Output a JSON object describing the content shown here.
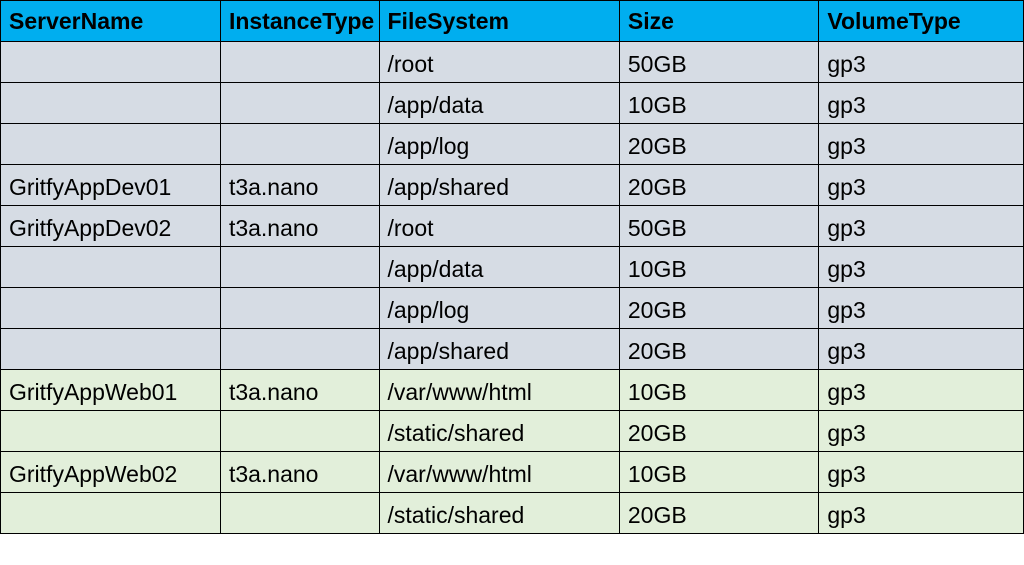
{
  "headers": {
    "server": "ServerName",
    "instance": "InstanceType",
    "fs": "FileSystem",
    "size": "Size",
    "volume": "VolumeType"
  },
  "rows": [
    {
      "server": "",
      "instance": "",
      "fs": "/root",
      "size": "50GB",
      "volume": "gp3",
      "group": "a"
    },
    {
      "server": "",
      "instance": "",
      "fs": "/app/data",
      "size": "10GB",
      "volume": "gp3",
      "group": "a"
    },
    {
      "server": "",
      "instance": "",
      "fs": "/app/log",
      "size": "20GB",
      "volume": "gp3",
      "group": "a"
    },
    {
      "server": "GritfyAppDev01",
      "instance": "t3a.nano",
      "fs": "/app/shared",
      "size": "20GB",
      "volume": "gp3",
      "group": "a"
    },
    {
      "server": "GritfyAppDev02",
      "instance": "t3a.nano",
      "fs": "/root",
      "size": "50GB",
      "volume": "gp3",
      "group": "a"
    },
    {
      "server": "",
      "instance": "",
      "fs": "/app/data",
      "size": "10GB",
      "volume": "gp3",
      "group": "a"
    },
    {
      "server": "",
      "instance": "",
      "fs": "/app/log",
      "size": "20GB",
      "volume": "gp3",
      "group": "a"
    },
    {
      "server": "",
      "instance": "",
      "fs": "/app/shared",
      "size": "20GB",
      "volume": "gp3",
      "group": "a"
    },
    {
      "server": "GritfyAppWeb01",
      "instance": "t3a.nano",
      "fs": "/var/www/html",
      "size": "10GB",
      "volume": "gp3",
      "group": "b"
    },
    {
      "server": "",
      "instance": "",
      "fs": "/static/shared",
      "size": "20GB",
      "volume": "gp3",
      "group": "b"
    },
    {
      "server": "GritfyAppWeb02",
      "instance": "t3a.nano",
      "fs": "/var/www/html",
      "size": "10GB",
      "volume": "gp3",
      "group": "b"
    },
    {
      "server": "",
      "instance": "",
      "fs": "/static/shared",
      "size": "20GB",
      "volume": "gp3",
      "group": "b"
    }
  ]
}
